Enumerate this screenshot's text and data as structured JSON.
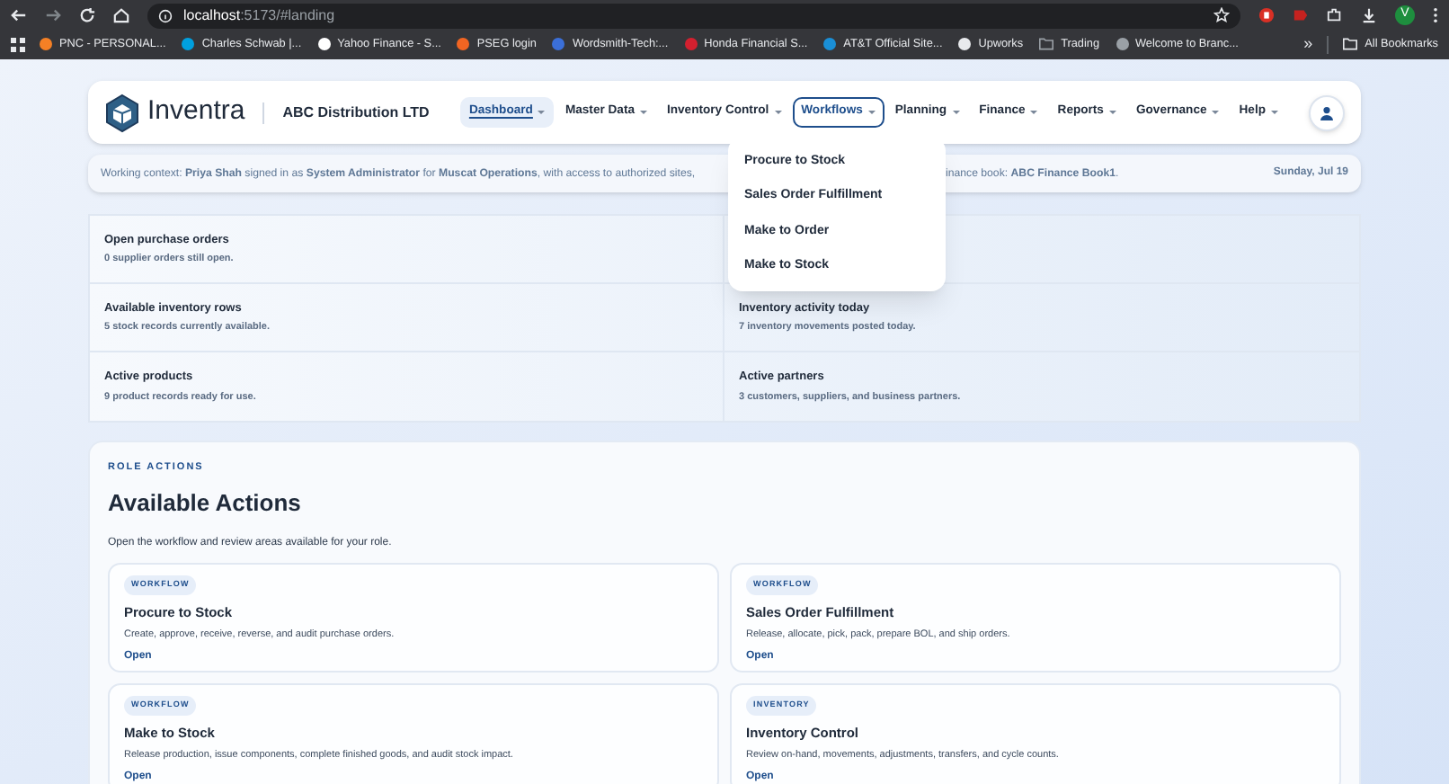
{
  "browser": {
    "url_host": "localhost",
    "url_path": ":5173/#landing",
    "profile_initial": "V",
    "more": "»",
    "all_bookmarks": "All Bookmarks",
    "bookmarks": [
      {
        "label": "PNC - PERSONAL...",
        "kind": "site",
        "color": "#f58025"
      },
      {
        "label": "Charles Schwab |...",
        "kind": "site",
        "color": "#00a0df"
      },
      {
        "label": "Yahoo Finance - S...",
        "kind": "site",
        "color": "#ffffff"
      },
      {
        "label": "PSEG login",
        "kind": "site",
        "color": "#f26522"
      },
      {
        "label": "Wordsmith-Tech:...",
        "kind": "site",
        "color": "#3b6fd8"
      },
      {
        "label": "Honda Financial S...",
        "kind": "site",
        "color": "#d3202f"
      },
      {
        "label": "AT&T Official Site...",
        "kind": "site",
        "color": "#1a8fd6"
      },
      {
        "label": "Upworks",
        "kind": "site",
        "color": "#e8eaed"
      },
      {
        "label": "Trading",
        "kind": "folder",
        "color": "#9aa0a6"
      },
      {
        "label": "Welcome to Branc...",
        "kind": "site",
        "color": "#9aa0a6"
      }
    ]
  },
  "header": {
    "brand": "Inventra",
    "company": "ABC Distribution LTD",
    "nav": [
      {
        "label": "Dashboard",
        "selected": true,
        "expanded": false
      },
      {
        "label": "Master Data",
        "selected": false,
        "expanded": false
      },
      {
        "label": "Inventory Control",
        "selected": false,
        "expanded": false
      },
      {
        "label": "Workflows",
        "selected": false,
        "expanded": true
      },
      {
        "label": "Planning",
        "selected": false,
        "expanded": false
      },
      {
        "label": "Finance",
        "selected": false,
        "expanded": false
      },
      {
        "label": "Reports",
        "selected": false,
        "expanded": false
      },
      {
        "label": "Governance",
        "selected": false,
        "expanded": false
      },
      {
        "label": "Help",
        "selected": false,
        "expanded": false
      }
    ]
  },
  "workflows_menu": [
    "Procure to Stock",
    "Sales Order Fulfillment",
    "Make to Order",
    "Make to Stock"
  ],
  "context_bar": {
    "text_start": "Working context: **Priya Shah** signed in as **System Administrator** for **Muscat Operations**, with access to authorized sites,",
    "text_end": "inance book: **ABC Finance Book1**.",
    "date": "Sunday, Jul 19"
  },
  "stat_rows": [
    {
      "left": {
        "title": "Open purchase orders",
        "detail": "0 supplier orders still open."
      }
    },
    {
      "left": {
        "title": "Available inventory rows",
        "detail": "5 stock records currently available."
      },
      "right": {
        "title": "Inventory activity today",
        "detail": "7 inventory movements posted today."
      }
    },
    {
      "left": {
        "title": "Active products",
        "detail": "9 product records ready for use."
      },
      "right": {
        "title": "Active partners",
        "detail": "3 customers, suppliers, and business partners."
      }
    }
  ],
  "actions": {
    "eyebrow": "ROLE ACTIONS",
    "title": "Available Actions",
    "subtitle": "Open the workflow and review areas available for your role.",
    "cards": [
      {
        "tag": "WORKFLOW",
        "title": "Procure to Stock",
        "description": "Create, approve, receive, reverse, and audit purchase orders.",
        "link": "Open"
      },
      {
        "tag": "WORKFLOW",
        "title": "Sales Order Fulfillment",
        "description": "Release, allocate, pick, pack, prepare BOL, and ship orders.",
        "link": "Open"
      },
      {
        "tag": "WORKFLOW",
        "title": "Make to Stock",
        "description": "Release production, issue components, complete finished goods, and audit stock impact.",
        "link": "Open"
      },
      {
        "tag": "INVENTORY",
        "title": "Inventory Control",
        "description": "Review on-hand, movements, adjustments, transfers, and cycle counts.",
        "link": "Open"
      }
    ]
  }
}
